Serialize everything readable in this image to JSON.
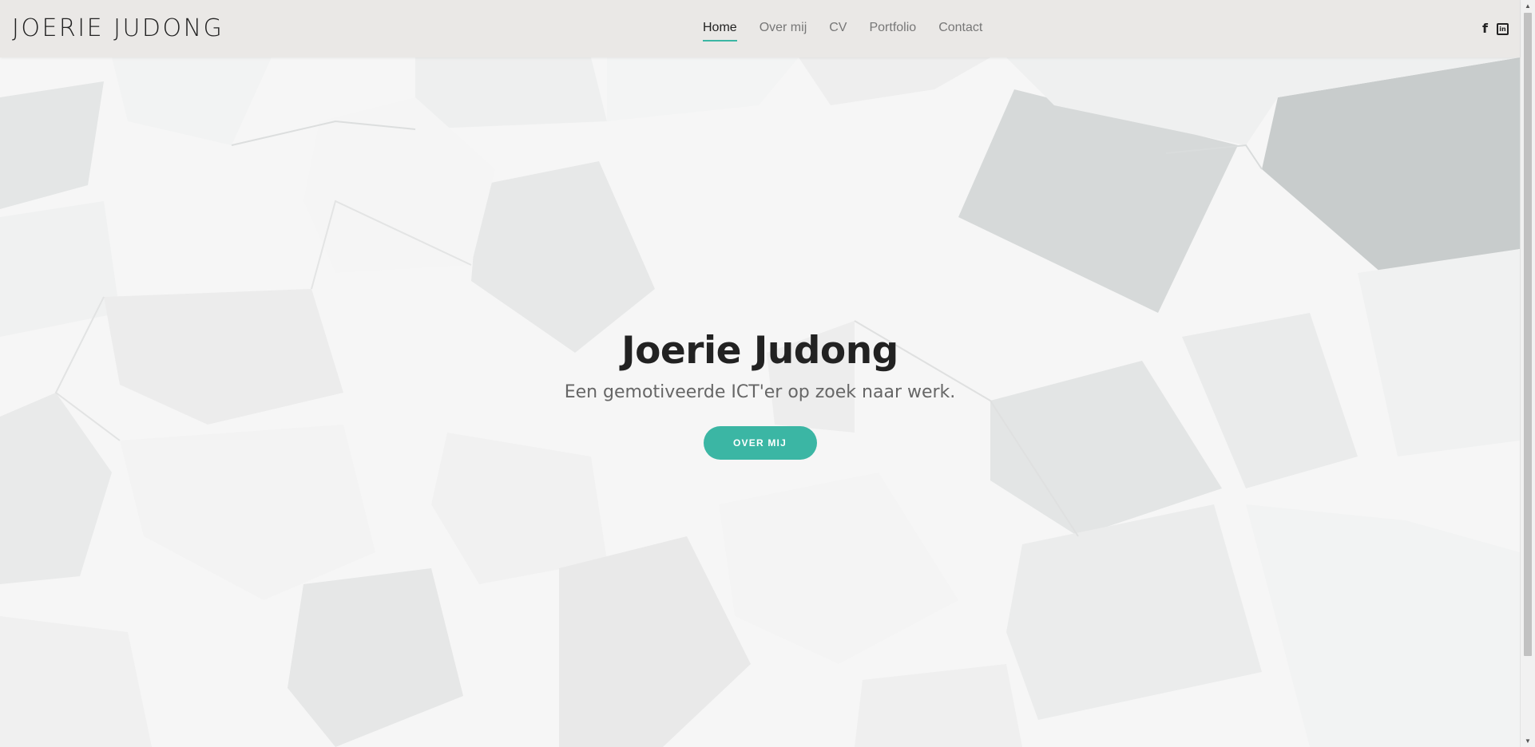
{
  "header": {
    "logo": "JOERIE JUDONG",
    "nav": [
      {
        "label": "Home",
        "active": true
      },
      {
        "label": "Over mij",
        "active": false
      },
      {
        "label": "CV",
        "active": false
      },
      {
        "label": "Portfolio",
        "active": false
      },
      {
        "label": "Contact",
        "active": false
      }
    ],
    "social": [
      {
        "icon": "facebook-icon",
        "glyph": "f"
      },
      {
        "icon": "linkedin-icon",
        "glyph": "in"
      }
    ]
  },
  "hero": {
    "title": "Joerie Judong",
    "subtitle": "Een gemotiveerde ICT'er op zoek naar werk.",
    "button_label": "OVER MIJ"
  },
  "scrollbar": {
    "up_glyph": "▲",
    "down_glyph": "▼"
  },
  "colors": {
    "accent": "#3bb6a4",
    "header_bg": "#eae8e6",
    "text_dark": "#222222"
  }
}
